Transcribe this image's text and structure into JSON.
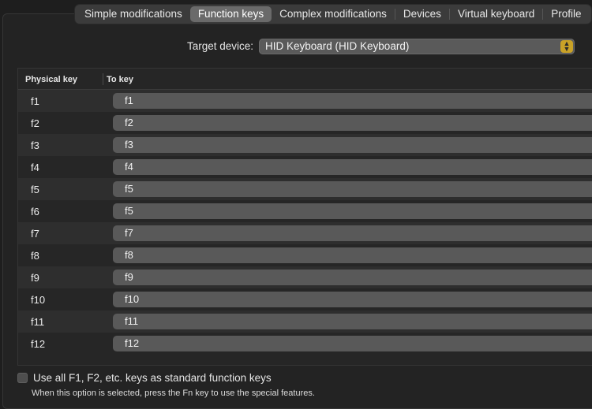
{
  "tabs": [
    {
      "label": "Simple modifications",
      "selected": false
    },
    {
      "label": "Function keys",
      "selected": true
    },
    {
      "label": "Complex modifications",
      "selected": false
    },
    {
      "label": "Devices",
      "selected": false
    },
    {
      "label": "Virtual keyboard",
      "selected": false
    },
    {
      "label": "Profile",
      "selected": false
    }
  ],
  "target": {
    "label": "Target device:",
    "value": "HID Keyboard (HID Keyboard)"
  },
  "table": {
    "headers": {
      "physical": "Physical key",
      "to": "To key"
    },
    "rows": [
      {
        "physical": "f1",
        "to": "f1"
      },
      {
        "physical": "f2",
        "to": "f2"
      },
      {
        "physical": "f3",
        "to": "f3"
      },
      {
        "physical": "f4",
        "to": "f4"
      },
      {
        "physical": "f5",
        "to": "f5"
      },
      {
        "physical": "f6",
        "to": "f5"
      },
      {
        "physical": "f7",
        "to": "f7"
      },
      {
        "physical": "f8",
        "to": "f8"
      },
      {
        "physical": "f9",
        "to": "f9"
      },
      {
        "physical": "f10",
        "to": "f10"
      },
      {
        "physical": "f11",
        "to": "f11"
      },
      {
        "physical": "f12",
        "to": "f12"
      }
    ]
  },
  "option": {
    "label": "Use all F1, F2, etc. keys as standard function keys",
    "checked": false,
    "description": "When this option is selected, press the Fn key to use the special features."
  },
  "colors": {
    "accent_select_arrow": "#c9a227",
    "selected_tab": "#6a6a6a",
    "field_bg": "#595959"
  }
}
